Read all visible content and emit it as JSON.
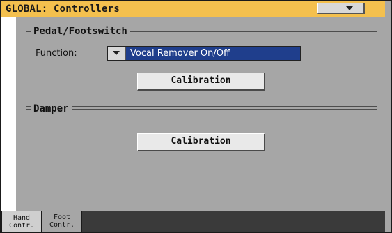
{
  "header": {
    "title": "GLOBAL: Controllers",
    "menu_icon": "chevron-down-icon"
  },
  "pedal_section": {
    "legend": "Pedal/Footswitch",
    "function_label": "Function:",
    "function_value": "Vocal Remover On/Off",
    "calibration_label": "Calibration"
  },
  "damper_section": {
    "legend": "Damper",
    "calibration_label": "Calibration"
  },
  "tabs": [
    {
      "line1": "Hand",
      "line2": "Contr.",
      "active": false
    },
    {
      "line1": "Foot",
      "line2": "Contr.",
      "active": true
    }
  ],
  "colors": {
    "title_bar": "#f4c04e",
    "panel_bg": "#a6a6a6",
    "selection_bg": "#1f3e8c"
  }
}
